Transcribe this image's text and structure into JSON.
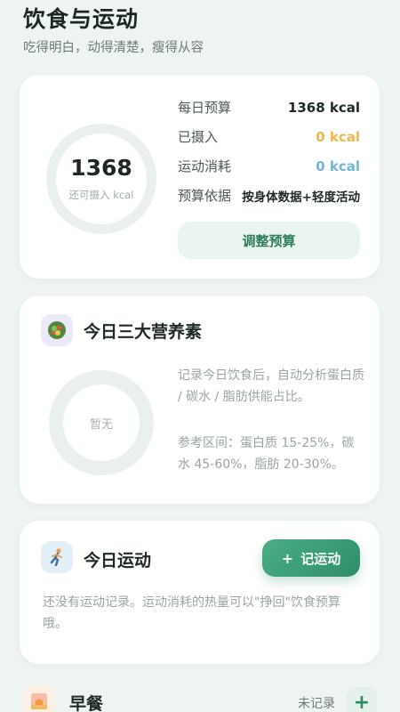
{
  "header": {
    "title": "饮食与运动",
    "subtitle": "吃得明白，动得清楚，瘦得从容"
  },
  "budget": {
    "remaining_value": "1368",
    "remaining_caption": "还可摄入 kcal",
    "rows": [
      {
        "label": "每日预算",
        "value": "1368 kcal"
      },
      {
        "label": "已摄入",
        "value": "0 kcal"
      },
      {
        "label": "运动消耗",
        "value": "0 kcal"
      },
      {
        "label": "预算依据",
        "value": "按身体数据+轻度活动"
      }
    ],
    "adjust_label": "调整预算"
  },
  "nutrients": {
    "title": "今日三大营养素",
    "icon": "salad-icon",
    "empty": "暂无",
    "description": "记录今日饮食后，自动分析蛋白质 / 碳水 / 脂肪供能占比。",
    "reference": "参考区间：蛋白质 15-25%，碳水 45-60%，脂肪 20-30%。"
  },
  "exercise": {
    "title": "今日运动",
    "icon": "running-icon",
    "add_label": "记运动",
    "empty": "还没有运动记录。运动消耗的热量可以\"挣回\"饮食预算哦。"
  },
  "meals": [
    {
      "name": "早餐",
      "status": "未记录",
      "icon": "sunrise-icon"
    }
  ],
  "colors": {
    "accent": "#2f8e68",
    "intake": "#f1b84b",
    "burn": "#72b6dc"
  }
}
